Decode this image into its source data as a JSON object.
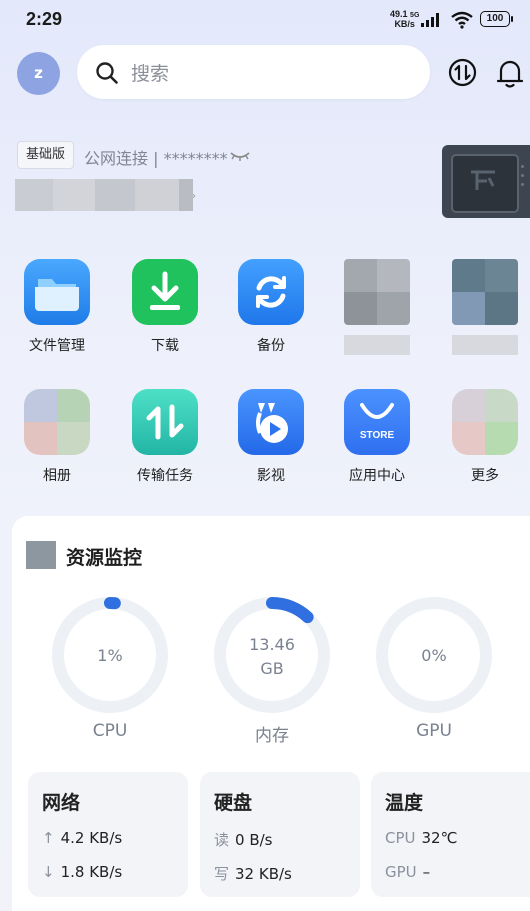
{
  "status_bar": {
    "time": "2:29",
    "net_speed_value": "49.1",
    "net_speed_unit": "KB/s",
    "signal": "5G",
    "battery": "100"
  },
  "header": {
    "avatar_letter": "z",
    "search_placeholder": "搜索"
  },
  "device": {
    "edition_badge": "基础版",
    "connection": "公网连接 | ********"
  },
  "apps": [
    {
      "label": "文件管理",
      "icon": "folder-icon",
      "color": "#2f8ff5"
    },
    {
      "label": "下载",
      "icon": "download-icon",
      "color": "#1fc25d"
    },
    {
      "label": "备份",
      "icon": "backup-icon",
      "color": "#2b86f0"
    },
    {
      "label": "相册",
      "icon": "photo-icon"
    },
    {
      "label": "传输任务",
      "icon": "transfer-icon",
      "color": "#2cc8b6"
    },
    {
      "label": "影视",
      "icon": "video-icon",
      "color": "#2f7ff0"
    },
    {
      "label": "应用中心",
      "icon": "store-icon",
      "color": "#3b7ff3",
      "text": "STORE"
    },
    {
      "label": "更多",
      "icon": "more-icon"
    }
  ],
  "monitor": {
    "title": "资源监控",
    "gauges": [
      {
        "name": "CPU",
        "value": "1%",
        "percent": 1
      },
      {
        "name": "内存",
        "value_line1": "13.46",
        "value_line2": "GB",
        "percent": 12
      },
      {
        "name": "GPU",
        "value": "0%",
        "percent": 0
      }
    ],
    "network": {
      "title": "网络",
      "upload": "4.2 KB/s",
      "download": "1.8 KB/s"
    },
    "disk": {
      "title": "硬盘",
      "read_label": "读",
      "read": "0 B/s",
      "write_label": "写",
      "write": "32 KB/s"
    },
    "temperature": {
      "title": "温度",
      "cpu_label": "CPU",
      "cpu": "32℃",
      "gpu_label": "GPU",
      "gpu": "–"
    }
  }
}
